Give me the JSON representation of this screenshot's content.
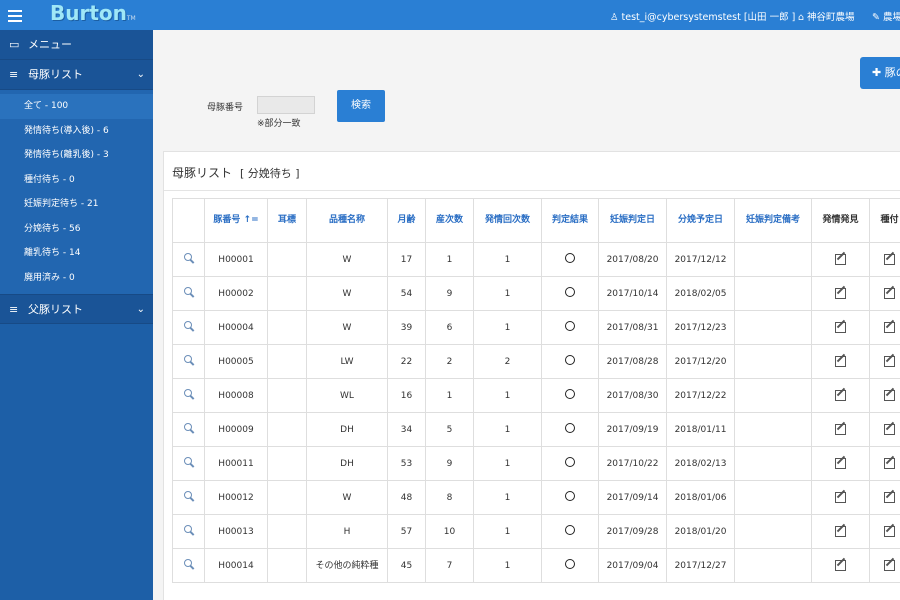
{
  "topbar": {
    "logo": "Burton",
    "logo_tm": "TM",
    "user": "test_i@cybersystemstest [山田 一郎 ]",
    "farm": "神谷町農場",
    "farm2": "農場"
  },
  "sidebar": {
    "menu_label": "メニュー",
    "sow_list_label": "母豚リスト",
    "boar_list_label": "父豚リスト",
    "items": [
      {
        "label": "全て - 100"
      },
      {
        "label": "発情待ち(導入後) - 6"
      },
      {
        "label": "発情待ち(離乳後) - 3"
      },
      {
        "label": "種付待ち - 0"
      },
      {
        "label": "妊娠判定待ち - 21"
      },
      {
        "label": "分娩待ち - 56"
      },
      {
        "label": "離乳待ち - 14"
      },
      {
        "label": "廃用済み - 0"
      }
    ]
  },
  "main": {
    "add_button": "豚の",
    "search_label": "母豚番号",
    "search_value": "",
    "search_hint": "※部分一致",
    "search_button": "検索",
    "panel_title": "母豚リスト",
    "panel_subtitle": "[ 分娩待ち ]",
    "columns": [
      "",
      "豚番号 ↑=",
      "耳標",
      "品種名称",
      "月齢",
      "産次数",
      "発情回次数",
      "判定結果",
      "妊娠判定日",
      "分娩予定日",
      "妊娠判定備考",
      "発情発見",
      "種付"
    ],
    "rows": [
      [
        "H00001",
        "",
        "W",
        "17",
        "1",
        "1",
        "2017/08/20",
        "2017/12/12",
        ""
      ],
      [
        "H00002",
        "",
        "W",
        "54",
        "9",
        "1",
        "2017/10/14",
        "2018/02/05",
        ""
      ],
      [
        "H00004",
        "",
        "W",
        "39",
        "6",
        "1",
        "2017/08/31",
        "2017/12/23",
        ""
      ],
      [
        "H00005",
        "",
        "LW",
        "22",
        "2",
        "2",
        "2017/08/28",
        "2017/12/20",
        ""
      ],
      [
        "H00008",
        "",
        "WL",
        "16",
        "1",
        "1",
        "2017/08/30",
        "2017/12/22",
        ""
      ],
      [
        "H00009",
        "",
        "DH",
        "34",
        "5",
        "1",
        "2017/09/19",
        "2018/01/11",
        ""
      ],
      [
        "H00011",
        "",
        "DH",
        "53",
        "9",
        "1",
        "2017/10/22",
        "2018/02/13",
        ""
      ],
      [
        "H00012",
        "",
        "W",
        "48",
        "8",
        "1",
        "2017/09/14",
        "2018/01/06",
        ""
      ],
      [
        "H00013",
        "",
        "H",
        "57",
        "10",
        "1",
        "2017/09/28",
        "2018/01/20",
        ""
      ],
      [
        "H00014",
        "",
        "その他の純粋種",
        "45",
        "7",
        "1",
        "2017/09/04",
        "2017/12/27",
        ""
      ]
    ]
  },
  "colors": {
    "accent": "#2a7fd4",
    "sidebar": "#1d5fa7",
    "header_text": "#2a6ec4"
  }
}
